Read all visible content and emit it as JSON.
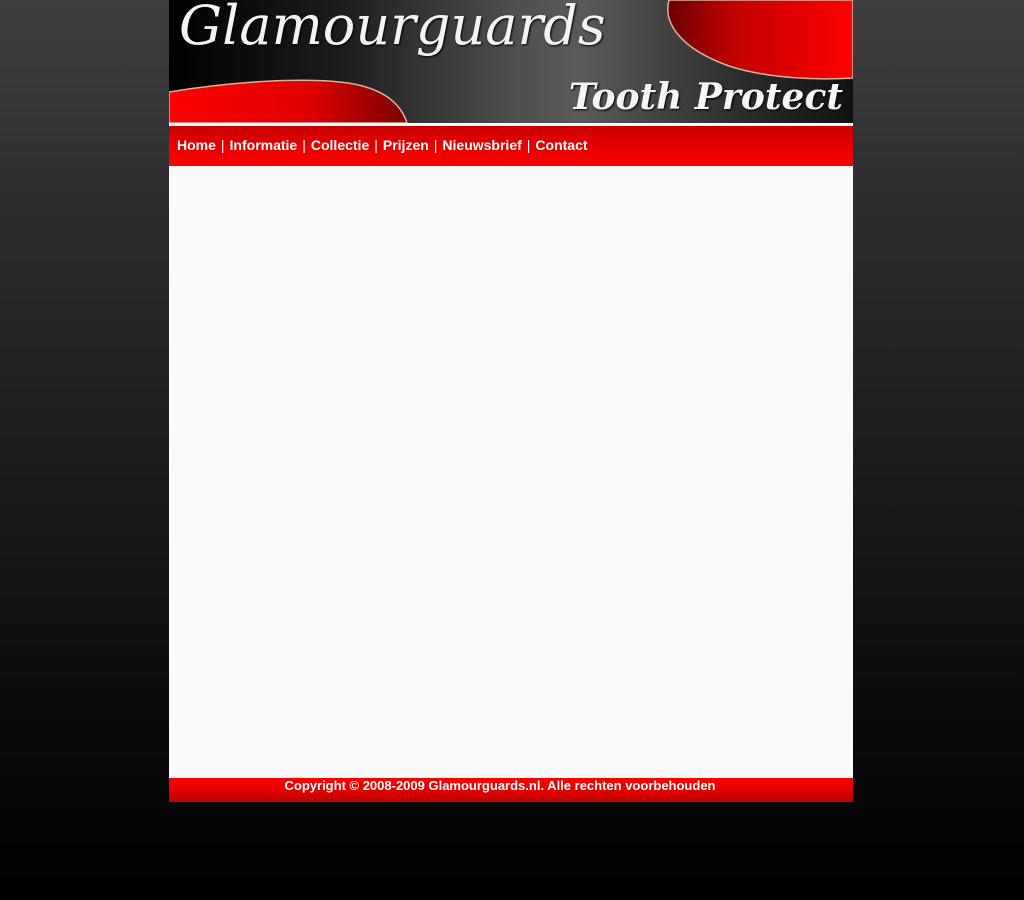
{
  "header": {
    "title": "Glamourguards",
    "tagline": "Tooth Protect"
  },
  "nav": {
    "items": [
      {
        "label": "Home"
      },
      {
        "label": "Informatie"
      },
      {
        "label": "Collectie"
      },
      {
        "label": "Prijzen"
      },
      {
        "label": "Nieuwsbrief"
      },
      {
        "label": "Contact"
      }
    ],
    "separator": "|"
  },
  "footer": {
    "copyright": "Copyright © 2008-2009 Glamourguards.nl. Alle rechten voorbehouden"
  },
  "colors": {
    "accent": "#ff0000",
    "page_background": "#000000",
    "content_background": "#fafafa",
    "text_on_accent": "#ffffff"
  }
}
